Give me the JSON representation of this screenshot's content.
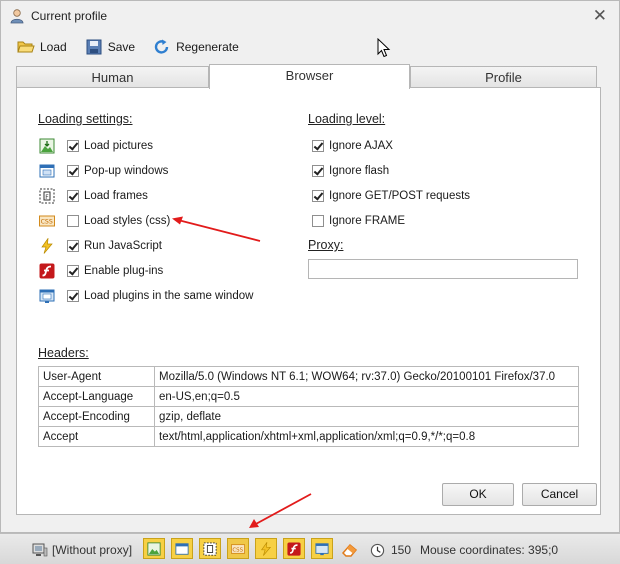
{
  "window": {
    "title": "Current profile"
  },
  "toolbar": {
    "load": "Load",
    "save": "Save",
    "regenerate": "Regenerate"
  },
  "tabs": [
    {
      "label": "Human"
    },
    {
      "label": "Browser"
    },
    {
      "label": "Profile"
    }
  ],
  "loading_settings": {
    "title": "Loading settings:",
    "items": [
      {
        "label": "Load pictures",
        "checked": true,
        "icon": "picture-icon"
      },
      {
        "label": "Pop-up windows",
        "checked": true,
        "icon": "popup-window-icon"
      },
      {
        "label": "Load frames",
        "checked": true,
        "icon": "frame-icon"
      },
      {
        "label": "Load styles (css)",
        "checked": false,
        "icon": "css-icon"
      },
      {
        "label": "Run JavaScript",
        "checked": true,
        "icon": "lightning-icon"
      },
      {
        "label": "Enable plug-ins",
        "checked": true,
        "icon": "flash-plugin-icon"
      },
      {
        "label": "Load plugins in the same window",
        "checked": true,
        "icon": "window-plugin-icon"
      }
    ]
  },
  "loading_level": {
    "title": "Loading level:",
    "items": [
      {
        "label": "Ignore AJAX",
        "checked": true
      },
      {
        "label": "Ignore flash",
        "checked": true
      },
      {
        "label": "Ignore GET/POST requests",
        "checked": true
      },
      {
        "label": "Ignore FRAME",
        "checked": false
      }
    ]
  },
  "proxy": {
    "label": "Proxy:",
    "value": ""
  },
  "headers": {
    "title": "Headers:",
    "rows": [
      {
        "name": "User-Agent",
        "value": "Mozilla/5.0 (Windows NT 6.1; WOW64; rv:37.0) Gecko/20100101 Firefox/37.0"
      },
      {
        "name": "Accept-Language",
        "value": "en-US,en;q=0.5"
      },
      {
        "name": "Accept-Encoding",
        "value": "gzip, deflate"
      },
      {
        "name": "Accept",
        "value": "text/html,application/xhtml+xml,application/xml;q=0.9,*/*;q=0.8"
      }
    ]
  },
  "buttons": {
    "ok": "OK",
    "cancel": "Cancel"
  },
  "statusbar": {
    "proxy": "[Without proxy]",
    "timer": "150",
    "mouse": "Mouse coordinates: 395;0"
  },
  "colors": {
    "arrow": "#e21b1b",
    "toggle": "#f7d044"
  }
}
